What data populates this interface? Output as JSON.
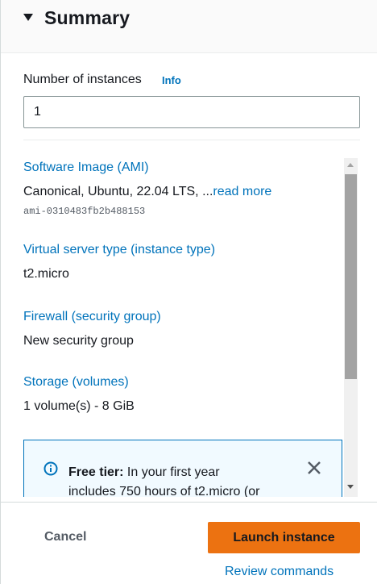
{
  "summary": {
    "title": "Summary"
  },
  "instances": {
    "label": "Number of instances",
    "info_label": "Info",
    "value": "1"
  },
  "details": {
    "ami": {
      "label": "Software Image (AMI)",
      "value": "Canonical, Ubuntu, 22.04 LTS, ...",
      "read_more": "read more",
      "id": "ami-0310483fb2b488153"
    },
    "instance_type": {
      "label": "Virtual server type (instance type)",
      "value": "t2.micro"
    },
    "firewall": {
      "label": "Firewall (security group)",
      "value": "New security group"
    },
    "storage": {
      "label": "Storage (volumes)",
      "value": "1 volume(s) - 8 GiB"
    }
  },
  "free_tier": {
    "title": "Free tier:",
    "text_line1": " In your first year",
    "text_line2": "includes 750 hours of t2.micro (or"
  },
  "footer": {
    "cancel_label": "Cancel",
    "launch_label": "Launch instance",
    "review_label": "Review commands"
  },
  "colors": {
    "accent": "#0073bb",
    "primary_button": "#ec7211",
    "text": "#16191f"
  },
  "icons": {
    "caret": "caret-down-icon",
    "info": "info-circle-icon",
    "close": "close-icon"
  }
}
